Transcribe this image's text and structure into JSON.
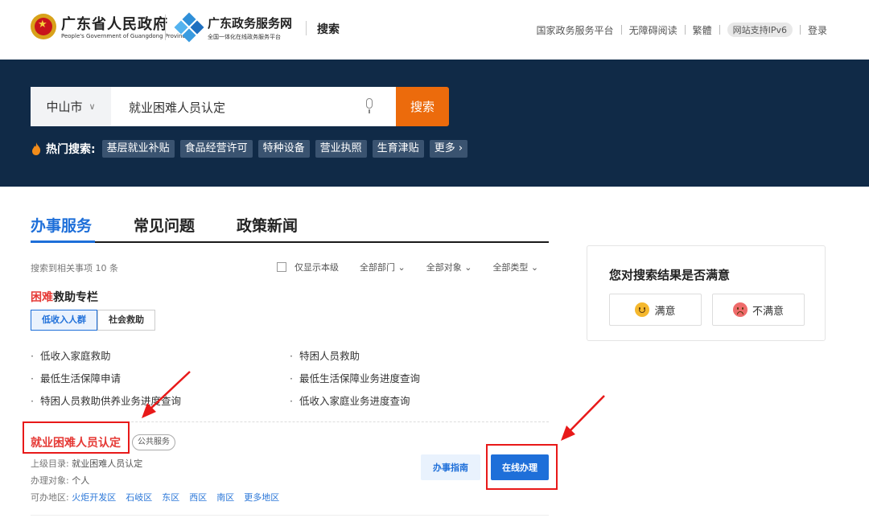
{
  "header": {
    "gov_name": "广东省人民政府",
    "gov_name_en": "People's Government of Guangdong Province",
    "portal_name": "广东政务服务网",
    "portal_sub": "全国一体化在线政务服务平台",
    "page": "搜索",
    "links": [
      "国家政务服务平台",
      "无障碍阅读",
      "繁體"
    ],
    "ipv6": "网站支持IPv6",
    "login": "登录"
  },
  "search": {
    "region": "中山市",
    "query": "就业困难人员认定",
    "button": "搜索",
    "hot_label": "热门搜索:",
    "hot_tags": [
      "基层就业补贴",
      "食品经营许可",
      "特种设备",
      "营业执照",
      "生育津贴"
    ],
    "more": "更多 ›"
  },
  "tabs": [
    "办事服务",
    "常见问题",
    "政策新闻"
  ],
  "filters": {
    "result_count": "搜索到相关事项 10 条",
    "only_local": "仅显示本级",
    "dept": "全部部门 ⌄",
    "target": "全部对象 ⌄",
    "type": "全部类型 ⌄"
  },
  "special": {
    "title_red": "困难",
    "title_rest": "救助专栏",
    "subtabs": [
      "低收入人群",
      "社会救助"
    ],
    "items": [
      "低收入家庭救助",
      "特困人员救助",
      "最低生活保障申请",
      "最低生活保障业务进度查询",
      "特困人员救助供养业务进度查询",
      "低收入家庭业务进度查询"
    ]
  },
  "result": {
    "title": "就业困难人员认定",
    "badge": "公共服务",
    "catalog_label": "上级目录:",
    "catalog_value": "就业困难人员认定",
    "target_label": "办理对象:",
    "target_value": "个人",
    "area_label": "可办地区:",
    "areas": [
      "火炬开发区",
      "石岐区",
      "东区",
      "西区",
      "南区",
      "更多地区"
    ],
    "guide_btn": "办事指南",
    "online_btn": "在线办理"
  },
  "satisfaction": {
    "title": "您对搜索结果是否满意",
    "yes": "满意",
    "no": "不满意"
  },
  "colors": {
    "banner": "#102a47",
    "accent_blue": "#1e6fd9",
    "search_orange": "#ec6b0c",
    "annotation_red": "#e81919"
  }
}
